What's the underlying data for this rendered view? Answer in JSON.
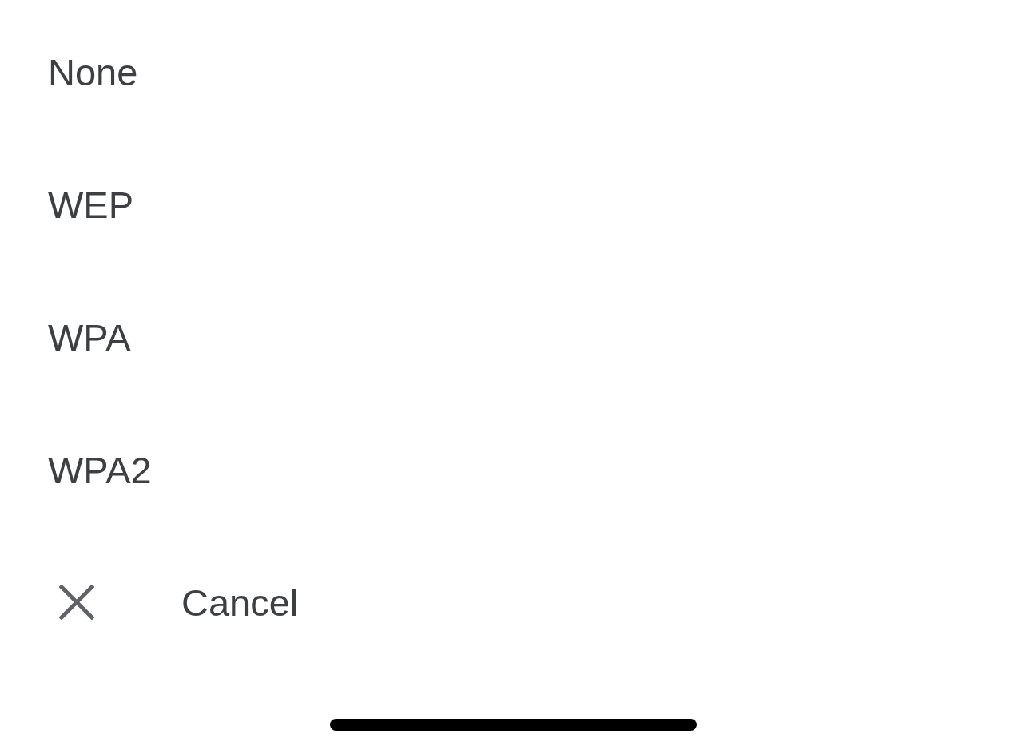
{
  "options": [
    {
      "label": "None"
    },
    {
      "label": "WEP"
    },
    {
      "label": "WPA"
    },
    {
      "label": "WPA2"
    }
  ],
  "cancel": {
    "label": "Cancel"
  }
}
